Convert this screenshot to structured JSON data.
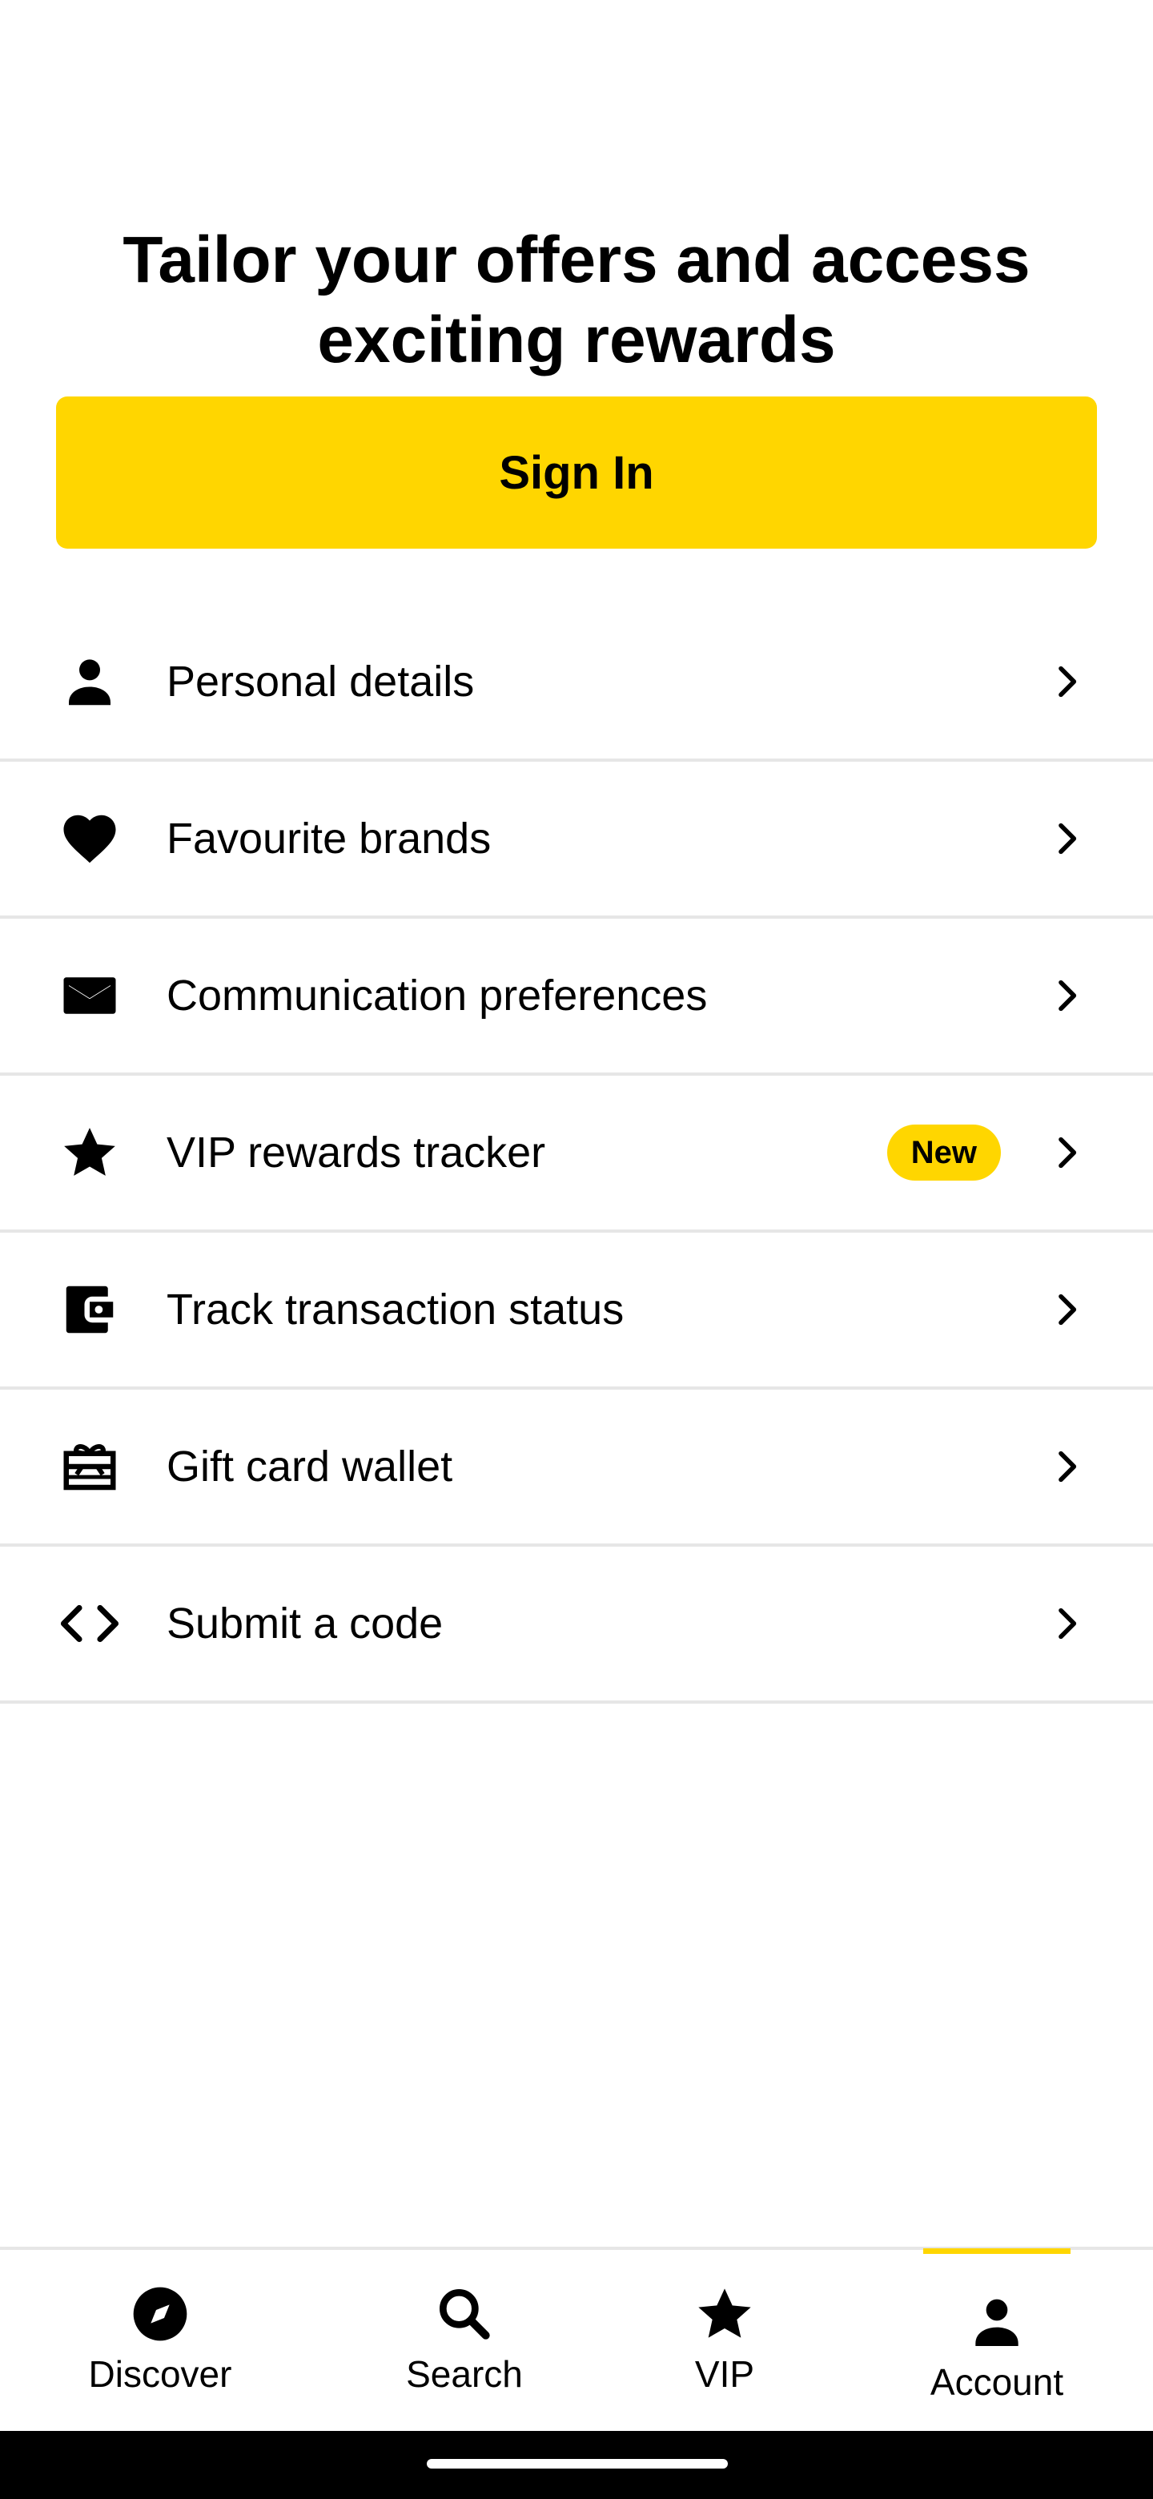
{
  "hero": {
    "title": "Tailor your offers and access exciting rewards"
  },
  "sign_in": {
    "label": "Sign In",
    "color": "#FFD600"
  },
  "menu": {
    "items": [
      {
        "label": "Personal details",
        "icon": "person-icon"
      },
      {
        "label": "Favourite brands",
        "icon": "heart-icon"
      },
      {
        "label": "Communication preferences",
        "icon": "mail-icon"
      },
      {
        "label": "VIP rewards tracker",
        "icon": "star-icon",
        "badge": "New"
      },
      {
        "label": "Track transaction status",
        "icon": "wallet-icon"
      },
      {
        "label": "Gift card wallet",
        "icon": "gift-card-icon"
      },
      {
        "label": "Submit a code",
        "icon": "code-icon"
      }
    ]
  },
  "bottom_nav": {
    "items": [
      {
        "label": "Discover",
        "icon": "compass-icon"
      },
      {
        "label": "Search",
        "icon": "search-icon"
      },
      {
        "label": "VIP",
        "icon": "star-icon"
      },
      {
        "label": "Account",
        "icon": "person-icon",
        "active": true
      }
    ]
  }
}
